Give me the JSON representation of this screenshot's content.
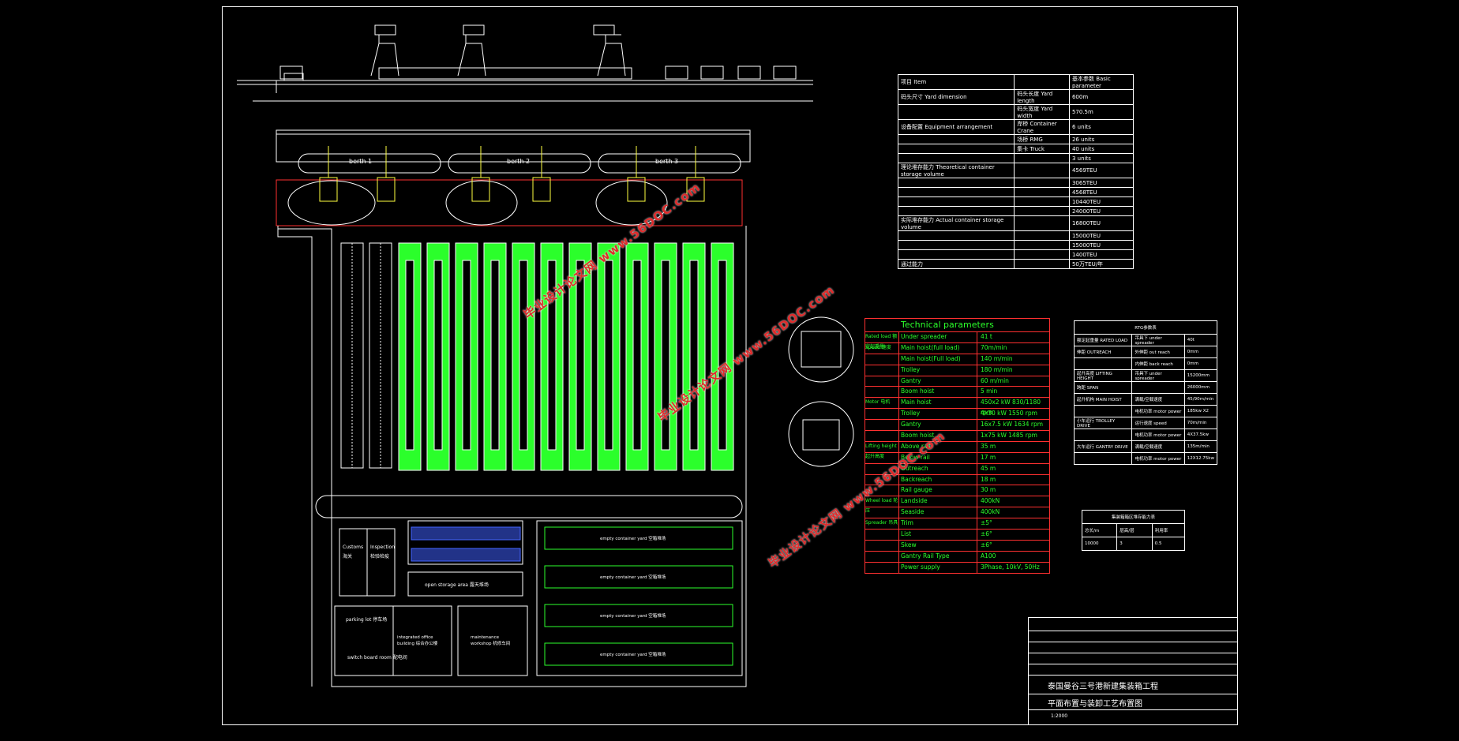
{
  "section_view": {
    "crane_label": "",
    "scale_label": ""
  },
  "plan": {
    "berths": [
      "berth 1",
      "berth 2",
      "berth 3"
    ],
    "zones": {
      "customs": "Customs",
      "customs_cn": "海关",
      "inspection": "Inspection",
      "inspection_cn": "检验检疫",
      "open_storage": "open storage area 露天堆场",
      "parking": "parking lot 停车场",
      "switch": "switch board room 配电间",
      "office": "integrated office building 综合办公楼",
      "workshop": "maintenance workshop 机修车间",
      "warehouse_label": "empty container yard 空箱堆场"
    }
  },
  "summary_table": {
    "header": [
      "项目 Item",
      "",
      "基本参数 Basic parameter"
    ],
    "rows": [
      [
        "码头尺寸 Yard dimension",
        "码头长度 Yard length",
        "600m"
      ],
      [
        "",
        "码头宽度 Yard width",
        "570.5m"
      ],
      [
        "设备配置 Equipment arrangement",
        "岸桥 Container Crane",
        "6 units"
      ],
      [
        "",
        "场桥 RMG",
        "26 units"
      ],
      [
        "",
        "集卡 Truck",
        "40 units"
      ],
      [
        "",
        "",
        "3 units"
      ],
      [
        "理论堆存能力 Theoretical container storage volume",
        "",
        "4569TEU"
      ],
      [
        "",
        "",
        "3065TEU"
      ],
      [
        "",
        "",
        "4568TEU"
      ],
      [
        "",
        "",
        "10440TEU"
      ],
      [
        "",
        "",
        "24000TEU"
      ],
      [
        "实际堆存能力 Actual container storage volume",
        "",
        "16800TEU"
      ],
      [
        "",
        "",
        "15000TEU"
      ],
      [
        "",
        "",
        "15000TEU"
      ],
      [
        "",
        "",
        "1400TEU"
      ],
      [
        "通过能力",
        "",
        "50万TEU/年"
      ]
    ]
  },
  "technical_parameters": {
    "title": "Technical parameters",
    "rows": [
      [
        "Rated load 额定起重量",
        "Under spreader",
        "41 t"
      ],
      [
        "Speed 速度",
        "Main hoist(full load)",
        "70m/min"
      ],
      [
        "",
        "Main hoist(Full load)",
        "140 m/min"
      ],
      [
        "",
        "Trolley",
        "180 m/min"
      ],
      [
        "",
        "Gantry",
        "60 m/min"
      ],
      [
        "",
        "Boom hoist",
        "5 min"
      ],
      [
        "Motor 电机",
        "Main hoist",
        "450x2 kW 830/1180 rpm"
      ],
      [
        "",
        "Trolley",
        "4x30 kW 1550 rpm"
      ],
      [
        "",
        "Gantry",
        "16x7.5 kW 1634 rpm"
      ],
      [
        "",
        "Boom hoist",
        "1x75 kW 1485 rpm"
      ],
      [
        "Lifting height 起升高度",
        "Above rail",
        "35 m"
      ],
      [
        "",
        "Below rail",
        "17 m"
      ],
      [
        "",
        "Outreach",
        "45 m"
      ],
      [
        "",
        "Backreach",
        "18 m"
      ],
      [
        "",
        "Rail gauge",
        "30 m"
      ],
      [
        "Wheel load 轮压",
        "Landside",
        "400kN"
      ],
      [
        "",
        "Seaside",
        "400kN"
      ],
      [
        "Spreader 吊具",
        "Trim",
        "±5°"
      ],
      [
        "",
        "List",
        "±6°"
      ],
      [
        "",
        "Skew",
        "±6°"
      ],
      [
        "",
        "Gantry Rail Type",
        "A100"
      ],
      [
        "",
        "Power supply",
        "3Phase, 10kV, 50Hz"
      ]
    ]
  },
  "rmg_table": {
    "header": "RTG参数表",
    "rows": [
      [
        "额定起重量 RATED LOAD",
        "吊具下 under spreader",
        "40t"
      ],
      [
        "伸距 OUTREACH",
        "外伸距 out reach",
        "0mm"
      ],
      [
        "",
        "内伸距 back reach",
        "0mm"
      ],
      [
        "起升高度 LIFTING HEIGHT",
        "吊具下 under spreader",
        "15200mm"
      ],
      [
        "跨距 SPAN",
        "",
        "26000mm"
      ],
      [
        "起升机构 MAIN HOIST",
        "满载/空载速度",
        "45/90m/min"
      ],
      [
        "",
        "电机功率 motor power",
        "185kw X2"
      ],
      [
        "小车运行 TROLLEY DRIVE",
        "运行速度 speed",
        "70m/min"
      ],
      [
        "",
        "电机功率 motor power",
        "4X37.5kw"
      ],
      [
        "大车运行 GANTRY DRIVE",
        "满载/空载速度",
        "135m/min"
      ],
      [
        "",
        "电机功率 motor power",
        "12X12.75kw"
      ]
    ]
  },
  "small_table": {
    "header": "集装箱箱区堆存能力表",
    "rows": [
      [
        "总长/m",
        "层高/层",
        "利用率"
      ],
      [
        "10000",
        "3",
        "0.5"
      ]
    ]
  },
  "title_block": {
    "project": "泰国曼谷三号港新建集装箱工程",
    "drawing": "平面布置与装卸工艺布置图",
    "scale": "1:2000"
  },
  "watermark": "毕业设计论文网 www.56DOC.com",
  "colors": {
    "green": "#2bff2b",
    "red": "#ff3030",
    "yellow": "#ffff40",
    "blue": "#4466ff",
    "white": "#ffffff"
  }
}
